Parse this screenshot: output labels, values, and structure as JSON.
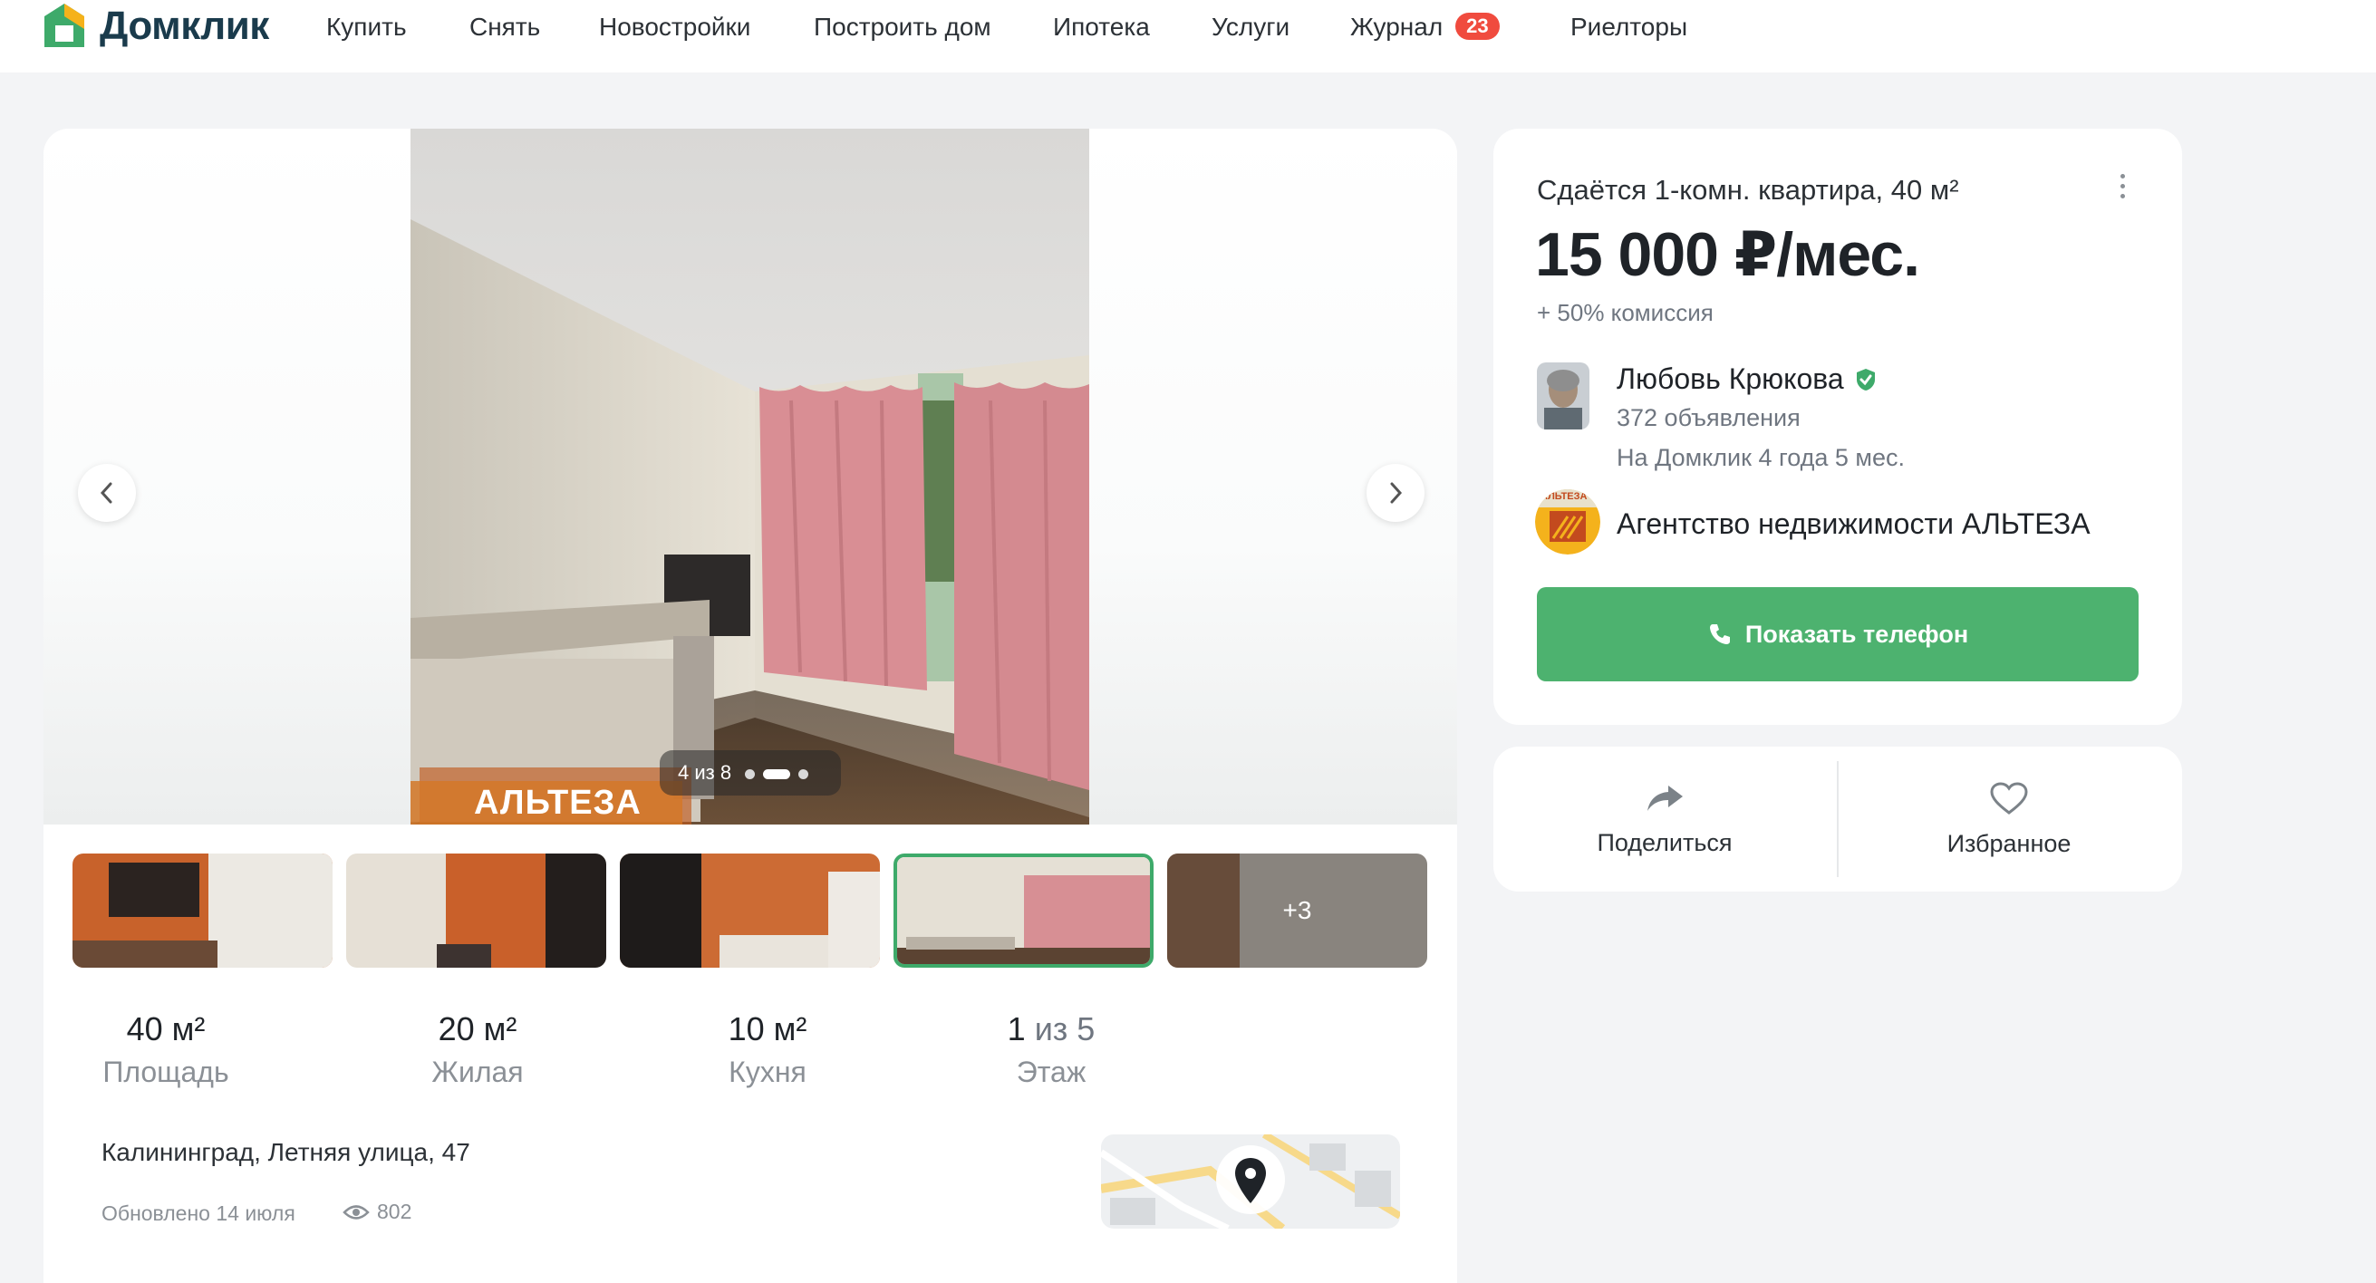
{
  "brand": {
    "name": "Домклик",
    "accent": "#3eaa6a",
    "dark": "#1a3b4c"
  },
  "nav": {
    "items": [
      {
        "label": "Купить"
      },
      {
        "label": "Снять"
      },
      {
        "label": "Новостройки"
      },
      {
        "label": "Построить дом"
      },
      {
        "label": "Ипотека"
      },
      {
        "label": "Услуги"
      },
      {
        "label": "Журнал",
        "badge": "23"
      },
      {
        "label": "Риелторы"
      }
    ]
  },
  "gallery": {
    "counter": "4 из 8",
    "watermark": "АЛЬТЕЗА",
    "more_label": "+3",
    "prev_icon": "chevron-left-icon",
    "next_icon": "chevron-right-icon"
  },
  "stats": [
    {
      "value": "40 м²",
      "label": "Площадь"
    },
    {
      "value": "20 м²",
      "label": "Жилая"
    },
    {
      "value": "10 м²",
      "label": "Кухня"
    },
    {
      "value_main": "1",
      "value_rest": " из 5",
      "label": "Этаж"
    }
  ],
  "location": {
    "address": "Калининград, Летняя улица, 47",
    "updated": "Обновлено 14 июля",
    "views": "802"
  },
  "listing": {
    "title": "Сдаётся 1-комн. квартира, 40 м²",
    "price": "15 000 ₽/мес.",
    "commission": "+ 50% комиссия"
  },
  "agent": {
    "name": "Любовь Крюкова",
    "listings": "372 объявления",
    "since": "На Домклик 4 года 5 мес.",
    "agency": "Агентство недвижимости АЛЬТЕЗА",
    "agency_logo_text": "АЛЬТЕЗА"
  },
  "actions": {
    "phone": "Показать телефон",
    "share": "Поделиться",
    "favorite": "Избранное"
  }
}
